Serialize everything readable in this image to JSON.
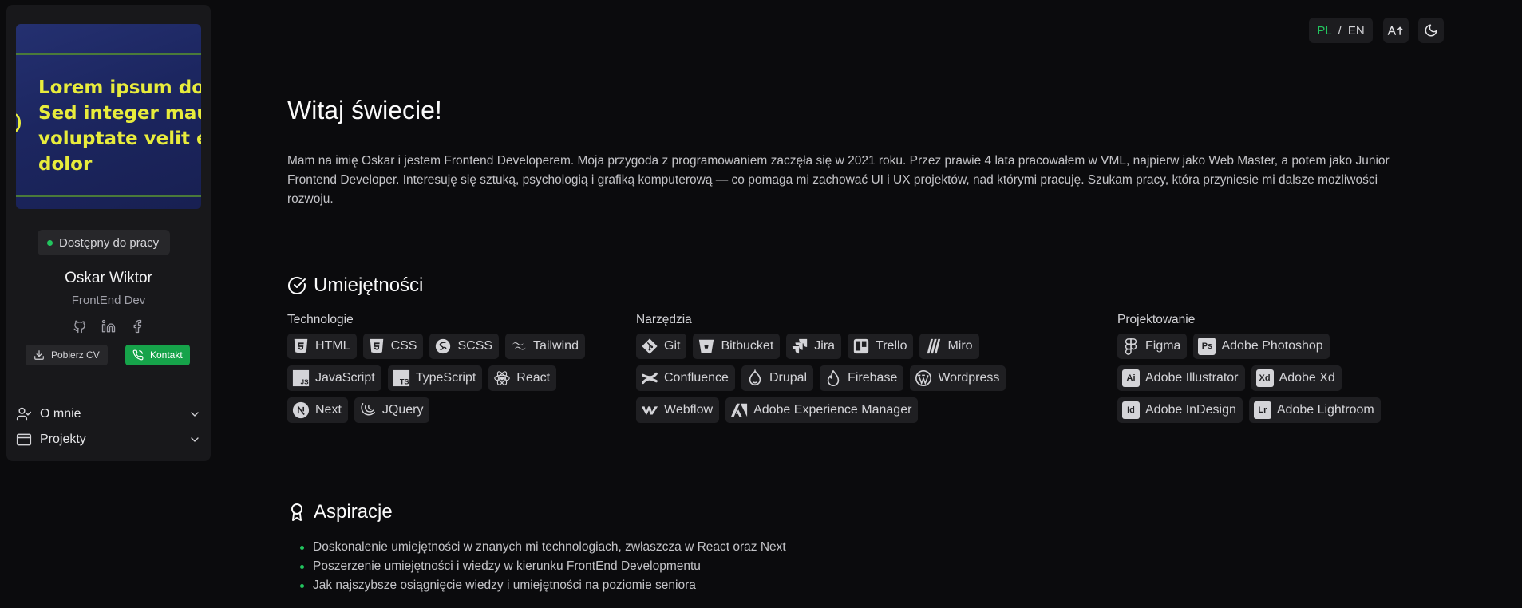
{
  "sidebar": {
    "banner_text": "Lorem ipsum dolor\nSed integer mauris\nvoluptate velit esse\ndolor",
    "status": "Dostępny do pracy",
    "name": "Oskar Wiktor",
    "role": "FrontEnd Dev",
    "download_cv": "Pobierz CV",
    "contact": "Kontakt",
    "nav": [
      {
        "label": "O mnie",
        "icon": "user-check-icon"
      },
      {
        "label": "Projekty",
        "icon": "browser-window-icon"
      }
    ]
  },
  "topbar": {
    "lang_pl": "PL",
    "lang_sep": "/",
    "lang_en": "EN"
  },
  "hero": {
    "title": "Witaj świecie!",
    "intro": "Mam na imię Oskar i jestem Frontend Developerem. Moja przygoda z programowaniem zaczęła się w 2021 roku. Przez prawie 4 lata pracowałem w VML, najpierw jako Web Master, a potem jako Junior Frontend Developer. Interesuję się sztuką, psychologią i grafiką komputerową — co pomaga mi zachować UI i UX projektów, nad którymi pracuję. Szukam pracy, która przyniesie mi dalsze możliwości rozwoju."
  },
  "skills": {
    "title": "Umiejętności",
    "technologies": {
      "label": "Technologie",
      "items": [
        "HTML",
        "CSS",
        "SCSS",
        "Tailwind",
        "JavaScript",
        "TypeScript",
        "React",
        "Next",
        "JQuery"
      ]
    },
    "tools": {
      "label": "Narzędzia",
      "items": [
        "Git",
        "Bitbucket",
        "Jira",
        "Trello",
        "Miro",
        "Confluence",
        "Drupal",
        "Firebase",
        "Wordpress",
        "Webflow",
        "Adobe Experience Manager"
      ]
    },
    "design": {
      "label": "Projektowanie",
      "items": [
        "Figma",
        "Adobe Photoshop",
        "Adobe Illustrator",
        "Adobe Xd",
        "Adobe InDesign",
        "Adobe Lightroom"
      ],
      "badges": [
        "Ps",
        "Ai",
        "Xd",
        "Id",
        "Lr"
      ]
    }
  },
  "aspirations": {
    "title": "Aspiracje",
    "items": [
      "Doskonalenie umiejętności w znanych mi technologiach, zwłaszcza w React oraz Next",
      "Poszerzenie umiejętności i wiedzy w kierunku FrontEnd Developmentu",
      "Jak najszybsze osiągnięcie wiedzy i umiejętności na poziomie seniora"
    ]
  },
  "colors": {
    "accent": "#22c55e",
    "background": "#0b0b0d",
    "panel": "#18181b",
    "chip": "#1f1f22"
  }
}
